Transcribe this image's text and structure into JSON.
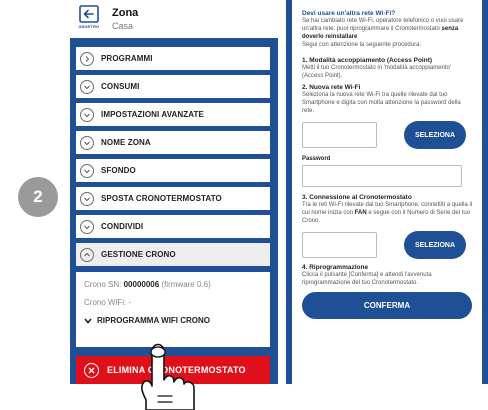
{
  "step_badge": "2",
  "left_screen": {
    "back_label": "INDIETRO",
    "zone_title": "Zona",
    "zone_subtitle": "Casa",
    "menu": [
      {
        "label": "PROGRAMMI",
        "icon": "chevron-right-icon"
      },
      {
        "label": "CONSUMI",
        "icon": "chevron-down-icon"
      },
      {
        "label": "IMPOSTAZIONI AVANZATE",
        "icon": "chevron-down-icon"
      },
      {
        "label": "NOME ZONA",
        "icon": "chevron-down-icon"
      },
      {
        "label": "SFONDO",
        "icon": "chevron-down-icon"
      },
      {
        "label": "SPOSTA CRONOTERMOSTATO",
        "icon": "chevron-down-icon"
      },
      {
        "label": "CONDIVIDI",
        "icon": "chevron-down-icon"
      },
      {
        "label": "GESTIONE CRONO",
        "icon": "chevron-up-icon"
      }
    ],
    "crono_sn_label": "Crono SN:",
    "crono_sn_value": "00000006",
    "crono_firmware": "(firmware 0.6)",
    "crono_wifi_label": "Crono WiFi:",
    "crono_wifi_value": "-",
    "reprogram_label": "RIPROGRAMMA WIFI CRONO",
    "delete_label": "ELIMINA CRONOTERMOSTATO"
  },
  "right_screen": {
    "heading": "Devi usare un'altra rete Wi-Fi?",
    "intro_part1": "Se hai cambiato rete Wi-Fi, operatore telefonico o vuoi usare un'altra rete, puoi riprogrammare il Cronotermostato",
    "intro_bold": "senza doverlo reinstallare",
    "intro_part2": "Segui con attenzione la seguente procedura:",
    "step1_title": "1. Modalità accoppiamento (Access Point)",
    "step1_text": "Metti il tuo Cronotermostato in 'modalità accoppiamento' (Access Point).",
    "step2_title": "2. Nuova rete Wi-Fi",
    "step2_text": "Seleziona la nuova rete Wi-Fi tra quelle rilevate dal tuo Smartphone e digita con molta attenzione la password della rete.",
    "select_button": "SELEZIONA",
    "password_label": "Password",
    "step3_title": "3. Connessione al Cronotermostato",
    "step3_text_part1": "Tra le reti Wi-Fi rilevate dal tuo Smartphone, connettiti a quella il cui nome inizia con",
    "step3_text_bold": "FAN",
    "step3_text_part2": "e segue con il Numero di Serie del tuo Crono.",
    "select_button_2": "SELEZIONA",
    "step4_title": "4. Riprogrammazione",
    "step4_text": "Clicca il pulsante [Conferma] e attendi l'avvenuta riprogrammazione del tuo Cronotermostato.",
    "confirm_button": "CONFERMA"
  },
  "colors": {
    "brand_blue": "#1f4f95",
    "danger_red": "#e0101a",
    "badge_gray": "#9a9a9a"
  }
}
